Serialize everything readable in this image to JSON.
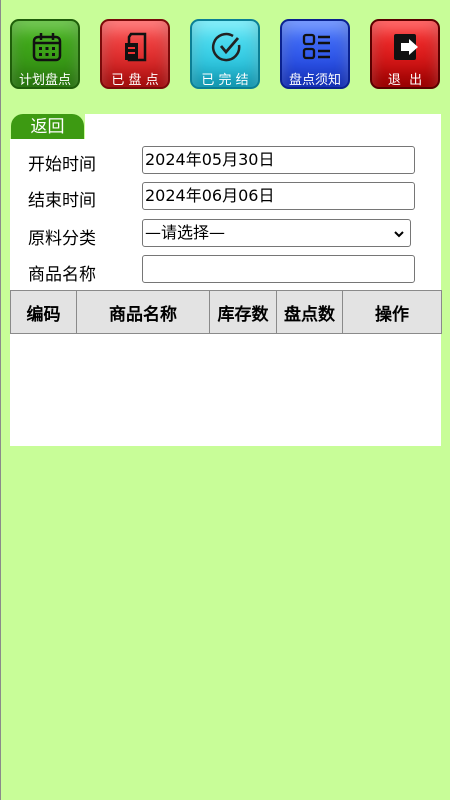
{
  "toolbar": {
    "buttons": [
      {
        "label": "计划盘点",
        "icon": "calendar-icon"
      },
      {
        "label": "已 盘 点",
        "icon": "document-icon"
      },
      {
        "label": "已 完 结",
        "icon": "check-circle-icon"
      },
      {
        "label": "盘点须知",
        "icon": "list-icon"
      },
      {
        "label": "退  出",
        "icon": "exit-icon"
      }
    ]
  },
  "back_label": "返回",
  "form": {
    "start_label": "开始时间",
    "start_value": "2024年05月30日",
    "end_label": "结束时间",
    "end_value": "2024年06月06日",
    "category_label": "原料分类",
    "category_selected": "—请选择—",
    "name_label": "商品名称",
    "name_value": ""
  },
  "table": {
    "columns": [
      "编码",
      "商品名称",
      "库存数",
      "盘点数",
      "操作"
    ],
    "rows": []
  },
  "colors": {
    "background": "#c8fd98",
    "back_tab": "#3d9a12"
  }
}
